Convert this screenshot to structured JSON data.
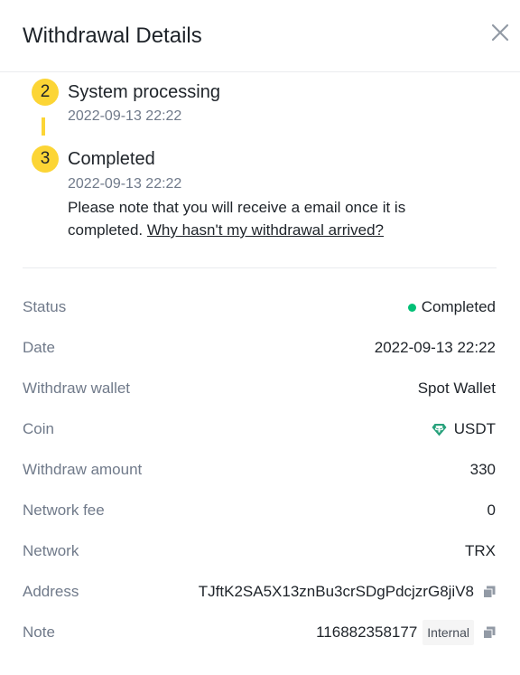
{
  "header": {
    "title": "Withdrawal Details"
  },
  "steps": [
    {
      "num": "2",
      "title": "System processing",
      "time": "2022-09-13 22:22"
    },
    {
      "num": "3",
      "title": "Completed",
      "time": "2022-09-13 22:22"
    }
  ],
  "note": {
    "text": "Please note that you will receive a email once it is completed. ",
    "link": "Why hasn't my withdrawal arrived?"
  },
  "details": {
    "status": {
      "label": "Status",
      "value": "Completed"
    },
    "date": {
      "label": "Date",
      "value": "2022-09-13 22:22"
    },
    "wallet": {
      "label": "Withdraw wallet",
      "value": "Spot Wallet"
    },
    "coin": {
      "label": "Coin",
      "value": "USDT",
      "icon": "tether-icon"
    },
    "amount": {
      "label": "Withdraw amount",
      "value": "330"
    },
    "fee": {
      "label": "Network fee",
      "value": "0"
    },
    "network": {
      "label": "Network",
      "value": "TRX"
    },
    "address": {
      "label": "Address",
      "value": "TJftK2SA5X13znBu3crSDgPdcjzrG8jiV8"
    },
    "note": {
      "label": "Note",
      "value": "116882358177",
      "tag": "Internal"
    }
  },
  "colors": {
    "accent": "#fcd535",
    "success": "#02c076",
    "tether": "#26a17b",
    "muted": "#707a8a"
  }
}
